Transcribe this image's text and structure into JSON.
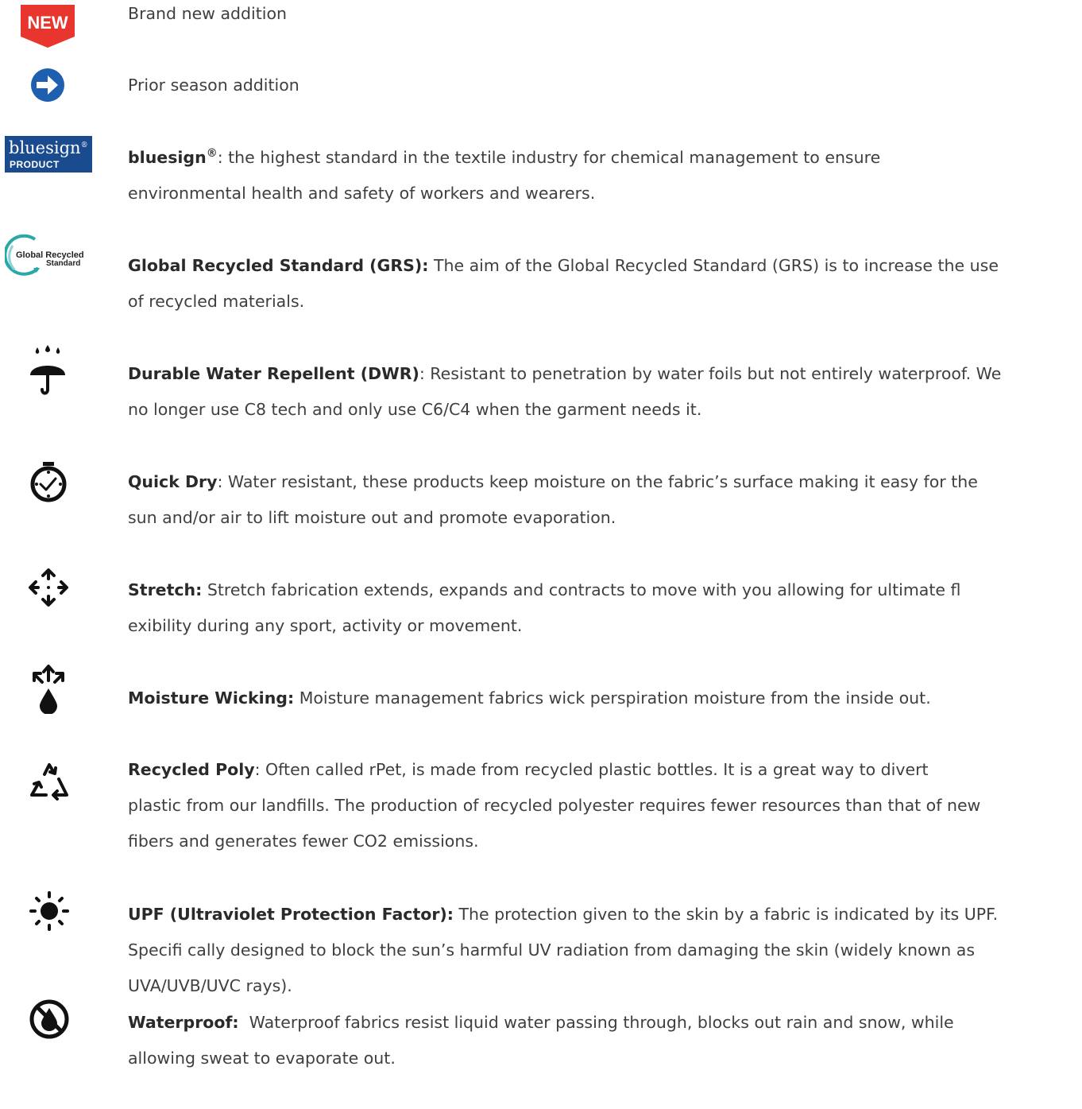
{
  "items": [
    {
      "icon": "new-badge-icon",
      "badge": "NEW",
      "title": "",
      "lines": [
        "Brand new addition"
      ]
    },
    {
      "icon": "arrow-right-circle-icon",
      "title": "",
      "lines": [
        "Prior season addition"
      ]
    },
    {
      "icon": "bluesign-logo",
      "logo_text": "bluesign",
      "logo_sub": "PRODUCT",
      "logo_mark": "®",
      "title": "bluesign",
      "title_sup": "®",
      "lines": [
        ": the highest standard in the textile industry for chemical management to ensure",
        "environmental health and safety of workers and wearers."
      ]
    },
    {
      "icon": "grs-logo",
      "logo_text": "Global Recycled",
      "logo_sub": "Standard",
      "title": "Global Recycled Standard (GRS):",
      "lines": [
        " The aim of the Global Recycled Standard (GRS) is to increase the use",
        "of recycled materials."
      ]
    },
    {
      "icon": "umbrella-rain-icon",
      "title": "Durable Water Repellent (DWR)",
      "lines": [
        ": Resistant to penetration by water foils but not entirely waterproof. We",
        "no longer use C8 tech and only use C6/C4 when the garment needs it."
      ]
    },
    {
      "icon": "stopwatch-icon",
      "title": "Quick Dry",
      "lines": [
        ": Water resistant, these products keep moisture on the fabric’s surface making it easy for the",
        "sun and/or air to lift moisture out and promote evaporation."
      ]
    },
    {
      "icon": "stretch-arrows-icon",
      "title": "Stretch:",
      "lines": [
        " Stretch fabrication extends, expands and contracts to move with you allowing for ultimate fl",
        "exibility during any sport, activity or movement."
      ]
    },
    {
      "icon": "moisture-wicking-icon",
      "title": "Moisture Wicking:",
      "lines": [
        " Moisture management fabrics wick perspiration moisture from the inside out."
      ]
    },
    {
      "icon": "recycle-icon",
      "title": "Recycled Poly",
      "lines": [
        ": Often called rPet, is made from recycled plastic bottles. It is a great way to divert",
        "plastic from our landfills. The production of recycled polyester requires fewer resources than that of new",
        "fibers and generates fewer CO2 emissions."
      ]
    },
    {
      "icon": "sun-icon",
      "title": "UPF (Ultraviolet Protection Factor):",
      "lines": [
        " The protection given to the skin by a fabric is indicated by its UPF.",
        "Specifi cally designed to block the sun’s harmful UV radiation from damaging the skin (widely known as",
        "UVA/UVB/UVC rays)."
      ]
    },
    {
      "icon": "waterproof-icon",
      "title": "Waterproof:",
      "lines": [
        "  Waterproof fabrics resist liquid water passing through, blocks out rain and snow, while",
        "allowing sweat to evaporate out."
      ]
    }
  ],
  "colors": {
    "new_badge": "#e8352e",
    "arrow": "#1e5fb0",
    "bluesign": "#1b4b8f",
    "grs": "#2aa7a7",
    "icon": "#111111",
    "text": "#3f3f3f"
  }
}
